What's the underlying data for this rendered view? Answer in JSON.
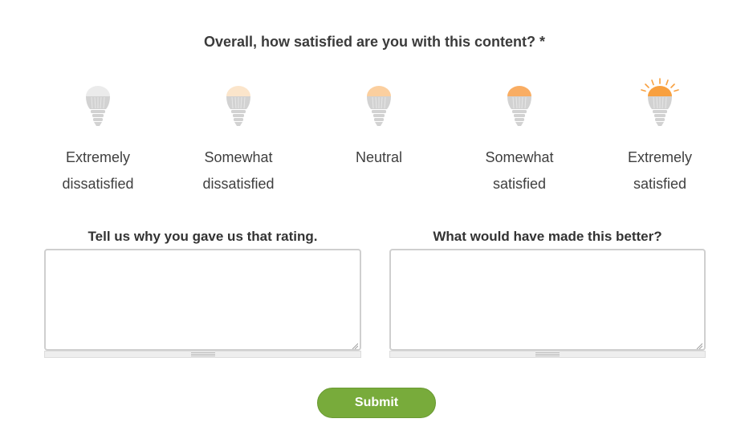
{
  "question": "Overall, how satisfied are you with this content? *",
  "rating_options": [
    {
      "line1": "Extremely",
      "line2": "dissatisfied",
      "cap_color": "#ebebeb",
      "rays": false
    },
    {
      "line1": "Somewhat",
      "line2": "dissatisfied",
      "cap_color": "#fbe5cb",
      "rays": false
    },
    {
      "line1": "Neutral",
      "line2": "",
      "cap_color": "#fbcf9f",
      "rays": false
    },
    {
      "line1": "Somewhat",
      "line2": "satisfied",
      "cap_color": "#f9ad63",
      "rays": false
    },
    {
      "line1": "Extremely",
      "line2": "satisfied",
      "cap_color": "#f8a03f",
      "rays": true
    }
  ],
  "feedback": {
    "why_label": "Tell us why you gave us that rating.",
    "better_label": "What would have made this better?",
    "why_value": "",
    "better_value": ""
  },
  "submit_label": "Submit",
  "colors": {
    "bulb_body": "#d2d2d2",
    "ray": "#f8a03f",
    "submit_bg": "#78ab3b"
  },
  "icons": {
    "bulb": "lightbulb-icon",
    "resize": "resize-handle-icon"
  }
}
